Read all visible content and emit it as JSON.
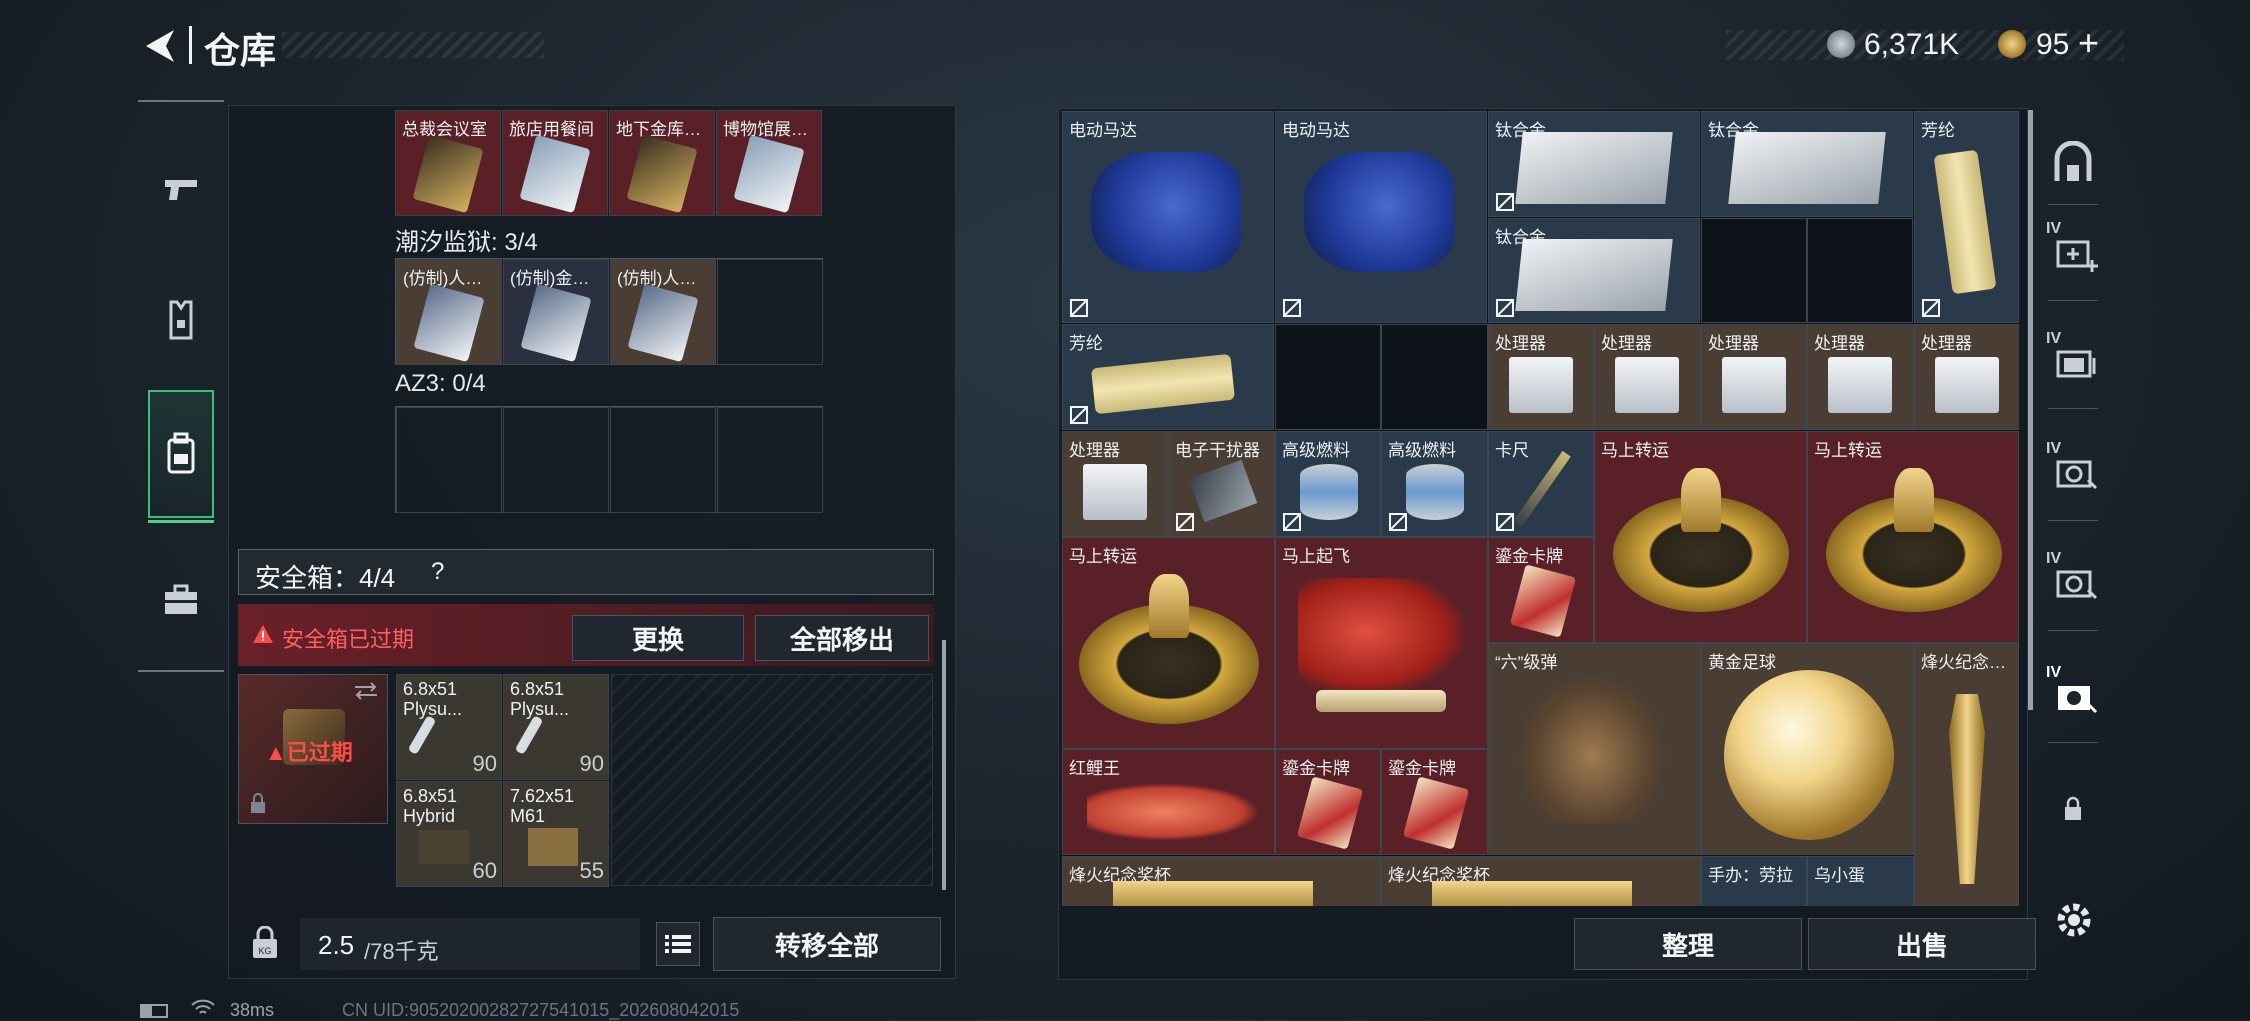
{
  "header": {
    "title": "仓库",
    "currency_amount": "6,371K",
    "premium_amount": "95",
    "premium_plus": "+"
  },
  "side_tabs": [
    "weapon-tab",
    "armor-tab",
    "backpack-tab",
    "case-tab"
  ],
  "left": {
    "key_cards_top": [
      "总裁会议室",
      "旅店用餐间",
      "地下金库…",
      "博物馆展…"
    ],
    "tide_prison_label": "潮汐监狱: 3/4",
    "tide_prison_items": [
      "(仿制)人…",
      "(仿制)金…",
      "(仿制)人…"
    ],
    "az3_label": "AZ3: 0/4",
    "safe_box": {
      "title": "安全箱：4/4",
      "help": "?",
      "expired_warning": "安全箱已过期",
      "replace_label": "更换",
      "remove_all_label": "全部移出",
      "expired_badge": "已过期"
    },
    "ammo": [
      {
        "name": "6.8x51\nPlysu...",
        "count": "90"
      },
      {
        "name": "6.8x51\nPlysu...",
        "count": "90"
      },
      {
        "name": "6.8x51\nHybrid",
        "count": "60"
      },
      {
        "name": "7.62x51\nM61",
        "count": "55"
      }
    ],
    "weight_value": "2.5",
    "weight_total": "/78千克",
    "transfer_all_label": "转移全部"
  },
  "right": {
    "items": [
      {
        "label": "电动马达"
      },
      {
        "label": "电动马达"
      },
      {
        "label": "钛合金"
      },
      {
        "label": "钛合金"
      },
      {
        "label": "芳纶"
      },
      {
        "label": "钛合金"
      },
      {
        "label": "芳纶"
      },
      {
        "label": "处理器"
      },
      {
        "label": "处理器"
      },
      {
        "label": "处理器"
      },
      {
        "label": "处理器"
      },
      {
        "label": "处理器"
      },
      {
        "label": "处理器"
      },
      {
        "label": "电子干扰器"
      },
      {
        "label": "高级燃料"
      },
      {
        "label": "高级燃料"
      },
      {
        "label": "卡尺"
      },
      {
        "label": "马上转运"
      },
      {
        "label": "马上转运"
      },
      {
        "label": "马上转运"
      },
      {
        "label": "马上起飞"
      },
      {
        "label": "鎏金卡牌"
      },
      {
        "label": "“六”级弹"
      },
      {
        "label": "黄金足球"
      },
      {
        "label": "烽火纪念…"
      },
      {
        "label": "红鲤王"
      },
      {
        "label": "鎏金卡牌"
      },
      {
        "label": "鎏金卡牌"
      },
      {
        "label": "烽火纪念奖杯"
      },
      {
        "label": "烽火纪念奖杯"
      },
      {
        "label": "手办：劳拉"
      },
      {
        "label": "乌小蛋"
      }
    ],
    "sort_label": "整理",
    "sell_label": "出售"
  },
  "right_rail_badges": [
    "IV",
    "IV",
    "IV",
    "IV",
    "IV"
  ],
  "status_bar": {
    "ping": "38ms",
    "uid": "CN UID:905202002827275410​15_202608042015"
  },
  "colors": {
    "red_item_bg": "#5a2028",
    "brown_item_bg": "#4a3d33",
    "blue_item_bg": "#2a3a4a",
    "accent_green": "#4bd18a",
    "warning_red": "#ff4b4b"
  }
}
